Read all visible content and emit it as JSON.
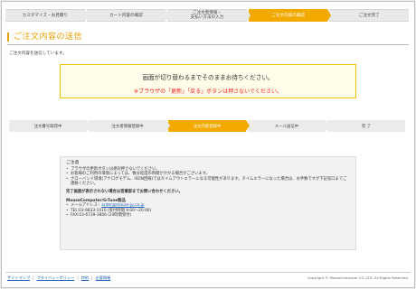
{
  "top_steps": [
    {
      "label": "カスタマイズ・お見積り",
      "active": false
    },
    {
      "label": "カート内容の確認",
      "active": false
    },
    {
      "label": "ご注文者情報・\n支払い方法の入力",
      "active": false
    },
    {
      "label": "ご注文内容の確認",
      "active": true
    },
    {
      "label": "ご注文完了",
      "active": false
    }
  ],
  "page_title": "ご注文内容の送信",
  "intro": "ご注文内容を送信しています。",
  "notice": {
    "main": "画面が切り替わるまでそのままお待ちください。",
    "warn_pre": "※ブラウザの「",
    "warn_k1": "更新",
    "warn_mid": "」「",
    "warn_k2": "戻る",
    "warn_post": "」ボタンは押さないでください。"
  },
  "progress_steps": [
    {
      "label": "注文番号取得中",
      "active": false
    },
    {
      "label": "注文者情報登録中",
      "active": false
    },
    {
      "label": "注文内容登録中",
      "active": true
    },
    {
      "label": "メール送信中",
      "active": false
    },
    {
      "label": "完 了",
      "active": false
    }
  ],
  "info": {
    "heading": "ご注意",
    "bullets": [
      "ブラウザの更新ボタンは絶対押さないでください。",
      "お客様のご利用の環境によっては、数分程度の時間がかかる場合がございます。",
      "ナローバンド環境(アナログモデム、ISDN回線)ではタイムアウトエラーになる可能性があります。タイムエラーになった場合は、お手数ですが下記窓口までご連絡ください。"
    ],
    "strong": "完了画面が表示されない場合は営業部までお問い合わせください。",
    "company": "MouseComputer/G-Tune製品",
    "mail_label": "メールアドレス：",
    "mail": "order@mouse-jp.co.jp",
    "tel": "TEL:03-6833-1010 (受付時間 9:00〜20:00)",
    "fax": "FAX:03-6739-3806 (24時間受付)"
  },
  "footer": {
    "links": [
      "サイトマップ",
      "プライバシーポリシー",
      "特約",
      "必要情報"
    ],
    "copyright": "Copyright © MouseComputer CO.,LTD. All Rights Reserved."
  }
}
